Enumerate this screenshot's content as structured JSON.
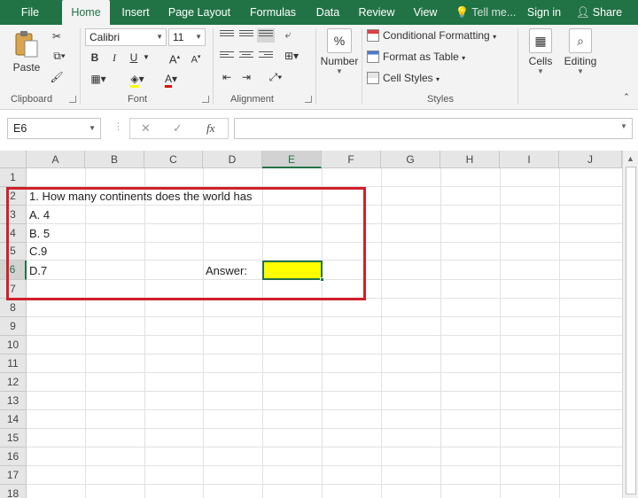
{
  "ribbon_tabs": [
    "File",
    "Home",
    "Insert",
    "Page Layout",
    "Formulas",
    "Data",
    "Review",
    "View",
    "Tell me...",
    "Sign in",
    "Share"
  ],
  "active_tab": "Home",
  "clipboard": {
    "paste_label": "Paste",
    "group_label": "Clipboard"
  },
  "font": {
    "name": "Calibri",
    "size": "11",
    "bold": "B",
    "italic": "I",
    "underline": "U",
    "grow": "A",
    "shrink": "A",
    "font_color": "A",
    "group_label": "Font"
  },
  "alignment": {
    "group_label": "Alignment"
  },
  "number": {
    "label": "Number",
    "symbol": "%"
  },
  "styles": {
    "conditional": "Conditional Formatting",
    "format_table": "Format as Table",
    "cell_styles": "Cell Styles",
    "group_label": "Styles"
  },
  "cells": {
    "label": "Cells"
  },
  "editing": {
    "label": "Editing"
  },
  "formula_bar": {
    "name_box": "E6",
    "cancel": "✕",
    "enter": "✓",
    "fx": "fx",
    "value": ""
  },
  "columns": [
    "A",
    "B",
    "C",
    "D",
    "E",
    "F",
    "G",
    "H",
    "I",
    "J"
  ],
  "selected_column": "E",
  "rows": [
    "1",
    "2",
    "3",
    "4",
    "5",
    "6",
    "7",
    "8",
    "9",
    "10",
    "11",
    "12",
    "13",
    "14",
    "15",
    "16",
    "17",
    "18"
  ],
  "selected_row": "6",
  "cells_content": {
    "A2": "1. How many continents does the world has",
    "A3": "A. 4",
    "A4": "B. 5",
    "A5": "C.9",
    "A6": "D.7",
    "D6": "Answer:"
  },
  "colors": {
    "excel_green": "#217346",
    "answer_fill": "#ffff00",
    "highlight_border": "#d0202a"
  }
}
